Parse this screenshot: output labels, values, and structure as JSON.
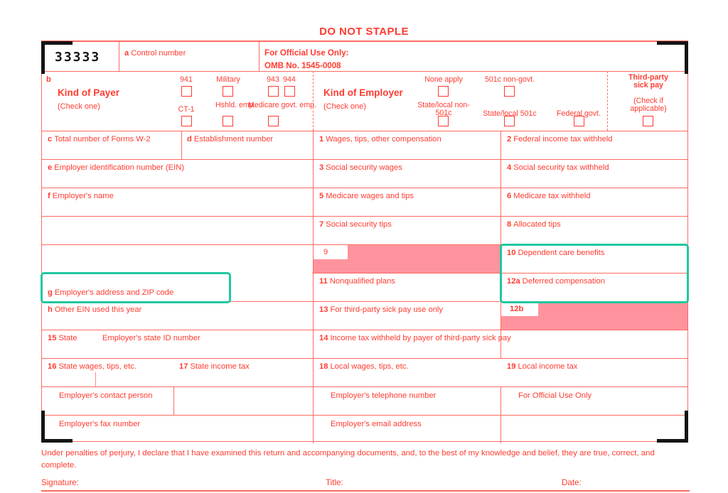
{
  "header": {
    "do_not_staple": "DO NOT STAPLE",
    "control_number_ocr": "33333",
    "control_number_label": "Control number",
    "control_number_letter": "a",
    "official_use_line1": "For Official Use Only:",
    "official_use_line2": "OMB No. 1545-0008"
  },
  "kind_of_payer": {
    "letter": "b",
    "title": "Kind of Payer",
    "subtitle": "(Check one)",
    "options": [
      {
        "label": "941",
        "checked": false
      },
      {
        "label": "Military",
        "checked": false
      },
      {
        "label": "943",
        "checked": false
      },
      {
        "label": "944",
        "checked": false
      },
      {
        "label": "CT-1",
        "checked": false
      },
      {
        "label": "Hshld. emp.",
        "checked": false
      },
      {
        "label": "Medicare govt. emp.",
        "checked": false
      }
    ]
  },
  "kind_of_employer": {
    "title": "Kind of Employer",
    "subtitle": "(Check one)",
    "options": [
      {
        "label": "None apply",
        "checked": false
      },
      {
        "label": "501c non-govt.",
        "checked": false
      },
      {
        "label": "State/local non-501c",
        "checked": false
      },
      {
        "label": "State/local 501c",
        "checked": false
      },
      {
        "label": "Federal govt.",
        "checked": false
      }
    ]
  },
  "third_party_sick_pay": {
    "title_line1": "Third-party",
    "title_line2": "sick pay",
    "note_line1": "(Check if",
    "note_line2": "applicable)",
    "checked": false
  },
  "left_boxes": {
    "c": {
      "letter": "c",
      "label": "Total number of Forms W-2",
      "value": ""
    },
    "d": {
      "letter": "d",
      "label": "Establishment number",
      "value": ""
    },
    "e": {
      "letter": "e",
      "label": "Employer identification number (EIN)",
      "value": ""
    },
    "f": {
      "letter": "f",
      "label": "Employer's name",
      "value": ""
    },
    "g": {
      "letter": "g",
      "label": "Employer's address and ZIP code",
      "value": ""
    },
    "h": {
      "letter": "h",
      "label": "Other EIN used this year",
      "value": ""
    }
  },
  "numbered_boxes": [
    {
      "num": "1",
      "label": "Wages, tips, other compensation",
      "value": "",
      "fill": "white",
      "highlight": false
    },
    {
      "num": "2",
      "label": "Federal income tax withheld",
      "value": "",
      "fill": "white",
      "highlight": false
    },
    {
      "num": "3",
      "label": "Social security wages",
      "value": "",
      "fill": "white",
      "highlight": false
    },
    {
      "num": "4",
      "label": "Social security tax withheld",
      "value": "",
      "fill": "white",
      "highlight": false
    },
    {
      "num": "5",
      "label": "Medicare wages and tips",
      "value": "",
      "fill": "white",
      "highlight": false
    },
    {
      "num": "6",
      "label": "Medicare tax withheld",
      "value": "",
      "fill": "white",
      "highlight": false
    },
    {
      "num": "7",
      "label": "Social security tips",
      "value": "",
      "fill": "white",
      "highlight": false
    },
    {
      "num": "8",
      "label": "Allocated tips",
      "value": "",
      "fill": "white",
      "highlight": false
    },
    {
      "num": "9",
      "label": "",
      "value": "",
      "fill": "pink",
      "highlight": false
    },
    {
      "num": "10",
      "label": "Dependent care benefits",
      "value": "",
      "fill": "white",
      "highlight": true
    },
    {
      "num": "11",
      "label": "Nonqualified plans",
      "value": "",
      "fill": "white",
      "highlight": true
    },
    {
      "num": "12a",
      "label": "Deferred compensation",
      "value": "",
      "fill": "white",
      "highlight": true
    },
    {
      "num": "13",
      "label": "For third-party sick pay use only",
      "value": "",
      "fill": "white",
      "highlight": false
    },
    {
      "num": "12b",
      "label": "",
      "value": "",
      "fill": "pink",
      "highlight": false
    },
    {
      "num": "14",
      "label": "Income tax withheld by payer of third-party sick pay",
      "value": "",
      "fill": "white",
      "highlight": false
    },
    {
      "num": "15",
      "label": "State",
      "value": "",
      "fill": "white",
      "highlight": false
    },
    {
      "num": "16",
      "label": "State wages, tips, etc.",
      "value": "",
      "fill": "white",
      "highlight": false
    },
    {
      "num": "17",
      "label": "State income tax",
      "value": "",
      "fill": "white",
      "highlight": false
    },
    {
      "num": "18",
      "label": "Local wages, tips, etc.",
      "value": "",
      "fill": "white",
      "highlight": false
    },
    {
      "num": "19",
      "label": "Local income tax",
      "value": "",
      "fill": "white",
      "highlight": false
    }
  ],
  "state_id_label": "Employer's state ID number",
  "contact": {
    "person": "Employer's contact person",
    "telephone": "Employer's telephone number",
    "official_use": "For Official Use Only",
    "fax": "Employer's fax number",
    "email": "Employer's email address"
  },
  "footer": {
    "perjury": "Under penalties of perjury, I declare that I have examined this return and accompanying documents, and, to the best of my knowledge and belief, they are true, correct, and complete.",
    "signature_label": "Signature:",
    "title_label": "Title:",
    "date_label": "Date:"
  },
  "colors": {
    "form_red": "#ff3b30",
    "rule_red": "#ff6b62",
    "pink_fill": "#ff939d",
    "teal_highlight": "#20c7a0",
    "bracket_black": "#141414"
  }
}
